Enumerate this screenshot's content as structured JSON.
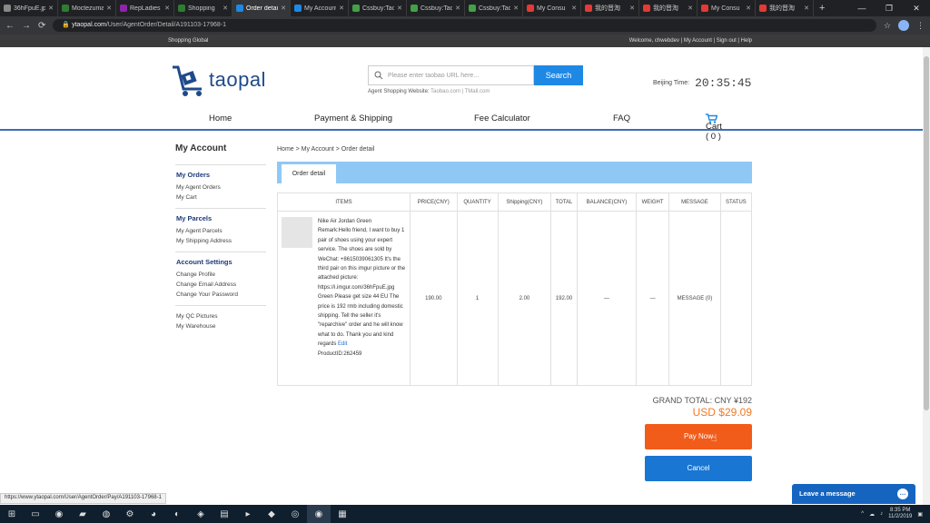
{
  "browser": {
    "tabs": [
      {
        "label": "36hFpuE.jpg",
        "color": "#888888"
      },
      {
        "label": "Moctezuma",
        "color": "#2e7d32"
      },
      {
        "label": "RepLadies",
        "color": "#8e24aa"
      },
      {
        "label": "Shopping",
        "color": "#2e7d32"
      },
      {
        "label": "Order detail",
        "color": "#1e88e5",
        "active": true
      },
      {
        "label": "My Account",
        "color": "#1e88e5"
      },
      {
        "label": "Cssbuy:Tao",
        "color": "#43a047"
      },
      {
        "label": "Cssbuy:Tao",
        "color": "#43a047"
      },
      {
        "label": "Cssbuy:Tao",
        "color": "#43a047"
      },
      {
        "label": "My Consu",
        "color": "#e53935"
      },
      {
        "label": "我的晋淘",
        "color": "#e53935"
      },
      {
        "label": "我的晋淘",
        "color": "#e53935"
      },
      {
        "label": "My Consu",
        "color": "#e53935"
      },
      {
        "label": "我的晋淘",
        "color": "#e53935"
      }
    ],
    "url_host": "ytaopal.com",
    "url_path": "/User/AgentOrder/Detail/A191103-17968-1",
    "status_url": "https://www.ytaopal.com/User/AgentOrder/Pay/A191103-17968-1"
  },
  "topstrip": {
    "left": "Shopping Global",
    "right": "Welcome, chwebdev  |  My Account  |  Sign out  |  Help"
  },
  "header": {
    "logo_text": "taopal",
    "search_placeholder": "Please enter taobao URL here...",
    "search_button": "Search",
    "agent_label": "Agent Shopping Website:",
    "agent_sites": "Taobao.com  |  TMall.com",
    "beijing_label": "Beijing Time:",
    "beijing_time": "20:35:45"
  },
  "nav": {
    "home": "Home",
    "payment": "Payment & Shipping",
    "fee": "Fee Calculator",
    "faq": "FAQ",
    "cart": "Cart ( 0 )"
  },
  "sidebar": {
    "title": "My Account",
    "sections": [
      {
        "heading": "My Orders",
        "items": [
          "My Agent Orders",
          "My Cart"
        ]
      },
      {
        "heading": "My Parcels",
        "items": [
          "My Agent Parcels",
          "My Shipping Address"
        ]
      },
      {
        "heading": "Account Settings",
        "items": [
          "Change Profile",
          "Change Email Address",
          "Change Your Password"
        ]
      },
      {
        "heading": "",
        "items": [
          "My QC Pictures",
          "My Warehouse"
        ]
      }
    ]
  },
  "main": {
    "breadcrumb": "Home > My Account > Order detail",
    "tab": "Order detail",
    "columns": [
      "ITEMS",
      "PRICE(CNY)",
      "QUANTITY",
      "Shipping(CNY)",
      "TOTAL",
      "BALANCE(CNY)",
      "WEIGHT",
      "MESSAGE",
      "STATUS"
    ],
    "item": {
      "description": "Nike Air Jordan Green Remark:Hello friend, I want to buy 1 pair of shoes using your expert service. The shoes are sold by WeChat: +8615039061305 It's the third pair on this imgur picture or the attached picture: https://i.imgur.com/36hFpuE.jpg Green Please get size 44 EU The price is 192 rmb including domestic shipping. Tell the seller it's \"reparchive\" order and he will know what to do. Thank you and kind regards",
      "edit": "Edit",
      "product_id": "ProductID:262459",
      "price": "190.00",
      "quantity": "1",
      "shipping": "2.00",
      "total": "192.00",
      "balance": "—",
      "weight": "—",
      "message": "MESSAGE (0)",
      "status": ""
    },
    "grand_total": "GRAND TOTAL: CNY ¥192",
    "usd": "USD $29.09",
    "pay_now": "Pay Now",
    "cancel": "Cancel"
  },
  "chat": {
    "label": "Leave a message"
  },
  "taskbar": {
    "time": "8:35 PM",
    "date": "11/2/2019"
  }
}
